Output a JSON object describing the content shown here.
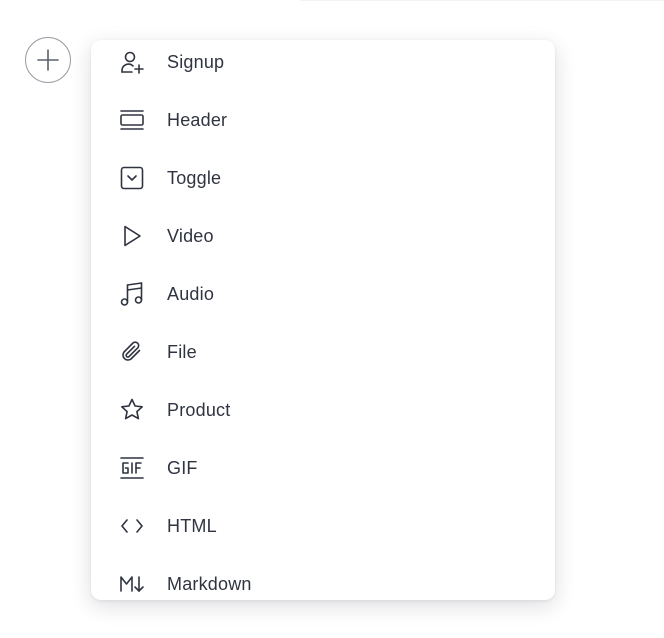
{
  "menu": {
    "items": [
      {
        "label": "Signup",
        "icon": "user-plus-icon"
      },
      {
        "label": "Header",
        "icon": "header-icon"
      },
      {
        "label": "Toggle",
        "icon": "toggle-icon"
      },
      {
        "label": "Video",
        "icon": "play-icon"
      },
      {
        "label": "Audio",
        "icon": "music-note-icon"
      },
      {
        "label": "File",
        "icon": "paperclip-icon"
      },
      {
        "label": "Product",
        "icon": "star-icon"
      },
      {
        "label": "GIF",
        "icon": "gif-icon"
      },
      {
        "label": "HTML",
        "icon": "code-icon"
      },
      {
        "label": "Markdown",
        "icon": "markdown-icon"
      }
    ]
  },
  "colors": {
    "text": "#2f3440",
    "icon": "#2f3440",
    "button_border": "#9a9ea6",
    "menu_background": "#ffffff"
  }
}
